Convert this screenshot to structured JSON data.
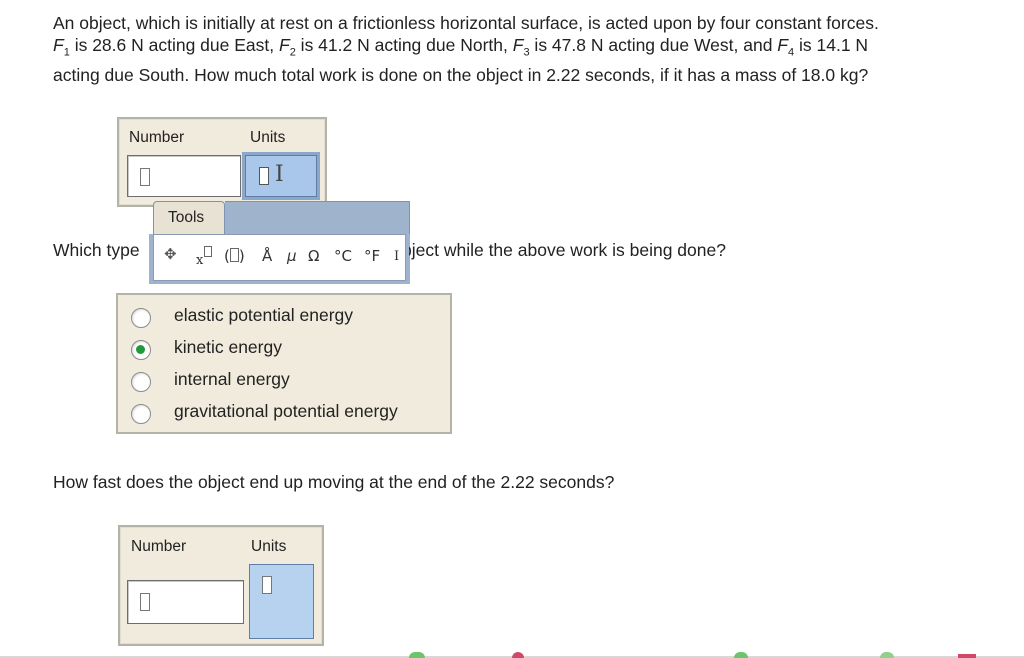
{
  "question1": {
    "p1": "An object, which is initially at rest on a frictionless horizontal surface, is acted upon by four constant forces.",
    "f1_sym": "F",
    "f1_sub": "1",
    "f1_text": " is 28.6 N acting due East, ",
    "f2_sym": "F",
    "f2_sub": "2",
    "f2_text": " is 41.2 N acting due North, ",
    "f3_sym": "F",
    "f3_sub": "3",
    "f3_text": " is 47.8 N acting due West, and ",
    "f4_sym": "F",
    "f4_sub": "4",
    "f4_text": " is 14.1 N",
    "p3": "acting due South. How much total work is done on the object in 2.22 seconds, if it has a mass of 18.0 kg?"
  },
  "answer1": {
    "number_label": "Number",
    "units_label": "Units",
    "ibeam": "I"
  },
  "tools": {
    "tab_label": "Tools",
    "items": [
      {
        "icon": "move-icon",
        "glyph": "✥"
      },
      {
        "icon": "superscript-icon",
        "glyph": "x"
      },
      {
        "icon": "parentheses-icon",
        "glyph": "( )"
      },
      {
        "icon": "angstrom-icon",
        "glyph": "Å"
      },
      {
        "icon": "mu-icon",
        "glyph": "μ"
      },
      {
        "icon": "omega-icon",
        "glyph": "Ω"
      },
      {
        "icon": "celsius-icon",
        "glyph": "°C"
      },
      {
        "icon": "fahrenheit-icon",
        "glyph": "°F"
      },
      {
        "icon": "ibeam-icon",
        "glyph": "I"
      }
    ]
  },
  "question2": {
    "prefix": "Which type",
    "suffix": "bject while the above work is being done?"
  },
  "choices": [
    {
      "label": "elastic potential energy",
      "checked": false
    },
    {
      "label": "kinetic energy",
      "checked": true
    },
    {
      "label": "internal energy",
      "checked": false
    },
    {
      "label": "gravitational potential energy",
      "checked": false
    }
  ],
  "question3": {
    "text": "How fast does the object end up moving at the end of the 2.22 seconds?"
  },
  "answer3": {
    "number_label": "Number",
    "units_label": "Units"
  },
  "colors": {
    "panel_bg": "#f0ebdc",
    "units_bg": "#b7d2ee",
    "selected_radio": "#1f9a3b"
  }
}
